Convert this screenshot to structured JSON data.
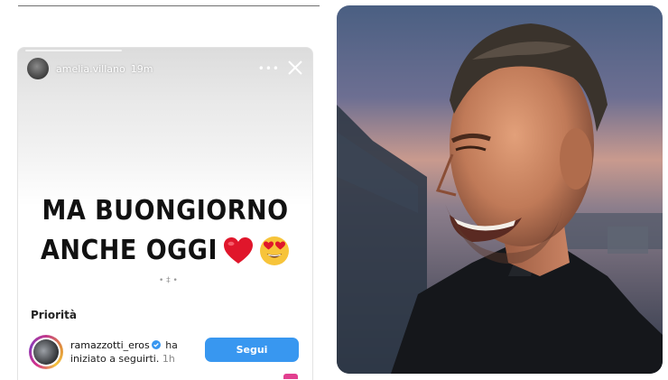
{
  "story": {
    "username": "amelia.villano",
    "time": "19m",
    "more_label": "•••",
    "headline_line1": "MA BUONGIORNO",
    "headline_line2": "ANCHE OGGI",
    "dot_mark": "• ‡ •"
  },
  "notification": {
    "section_title": "Priorità",
    "user": "ramazzotti_eros",
    "text": "ha iniziato a seguirti.",
    "time": "1h",
    "follow_label": "Segui"
  },
  "colors": {
    "follow_button": "#3897f0",
    "heart": "#e0162b",
    "accent_pink": "#e23f8f"
  },
  "icons": [
    "close-icon",
    "more-icon",
    "heart-icon",
    "heart-eyes-icon",
    "verified-icon"
  ]
}
